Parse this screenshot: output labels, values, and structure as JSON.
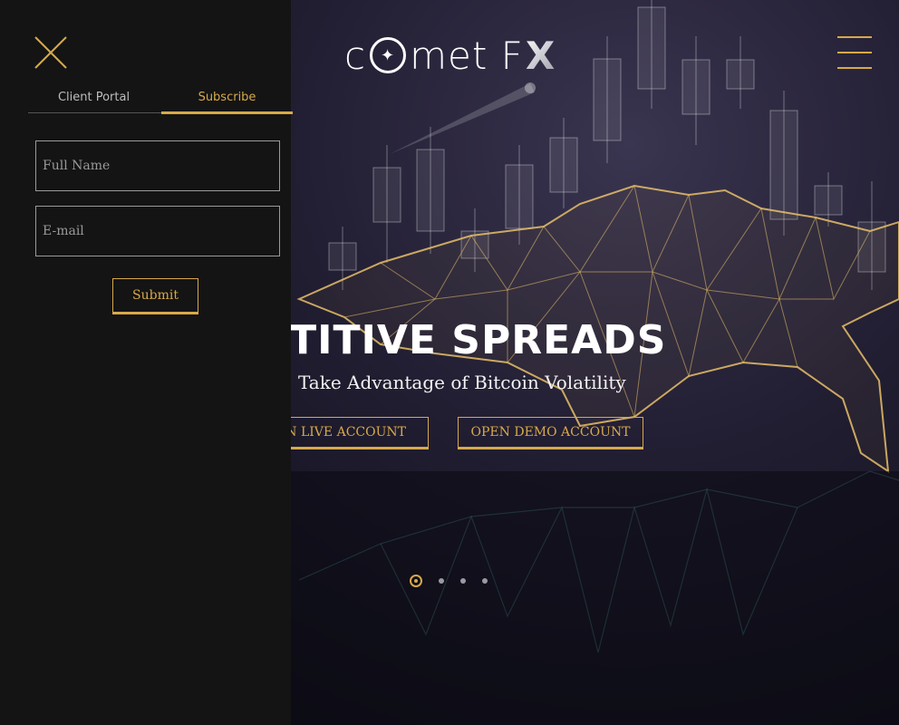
{
  "brand": {
    "name_prefix": "c",
    "name_mid": "met F",
    "name_suffix": "X"
  },
  "hero": {
    "heading": "MPETITIVE SPREADS",
    "subtitle": "Take Advantage of Bitcoin Volatility",
    "live_button": "PEN LIVE ACCOUNT",
    "demo_button": "OPEN DEMO ACCOUNT",
    "slides": {
      "count": 4,
      "active": 1
    }
  },
  "side_panel": {
    "tabs": [
      {
        "label": "Client Portal",
        "active": false
      },
      {
        "label": "Subscribe",
        "active": true
      }
    ],
    "full_name_placeholder": "Full Name",
    "email_placeholder": "E-mail",
    "submit_label": "Submit"
  },
  "colors": {
    "accent": "#d8a94a",
    "panel_bg": "#141414",
    "hero_bg": "#231f34"
  },
  "icons": {
    "close": "close-icon",
    "menu": "hamburger-menu-icon"
  }
}
